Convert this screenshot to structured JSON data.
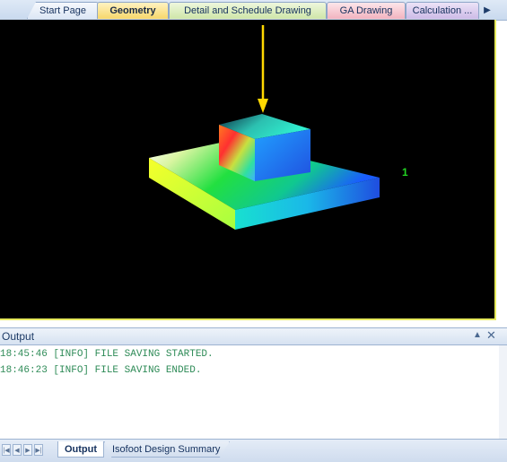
{
  "tabs": [
    {
      "label": "Start Page"
    },
    {
      "label": "Geometry"
    },
    {
      "label": "Detail and Schedule Drawing"
    },
    {
      "label": "GA Drawing"
    },
    {
      "label": "Calculation ..."
    }
  ],
  "active_tab": "Geometry",
  "viewport": {
    "background": "#000000",
    "border_color": "#e5e95c",
    "axis_label": "1",
    "arrow_color": "#ffd800"
  },
  "output": {
    "title": "Output",
    "lines": [
      "18:45:46 [INFO] FILE SAVING STARTED.",
      "18:46:23 [INFO] FILE SAVING ENDED."
    ],
    "text_color": "#2e8b57"
  },
  "icons": {
    "pin": "pin-icon",
    "close": "close-icon",
    "tabs_scroll": "chevron-right-icon"
  },
  "bottom_tabs": [
    {
      "label": "Output"
    },
    {
      "label": "Isofoot Design Summary"
    }
  ]
}
